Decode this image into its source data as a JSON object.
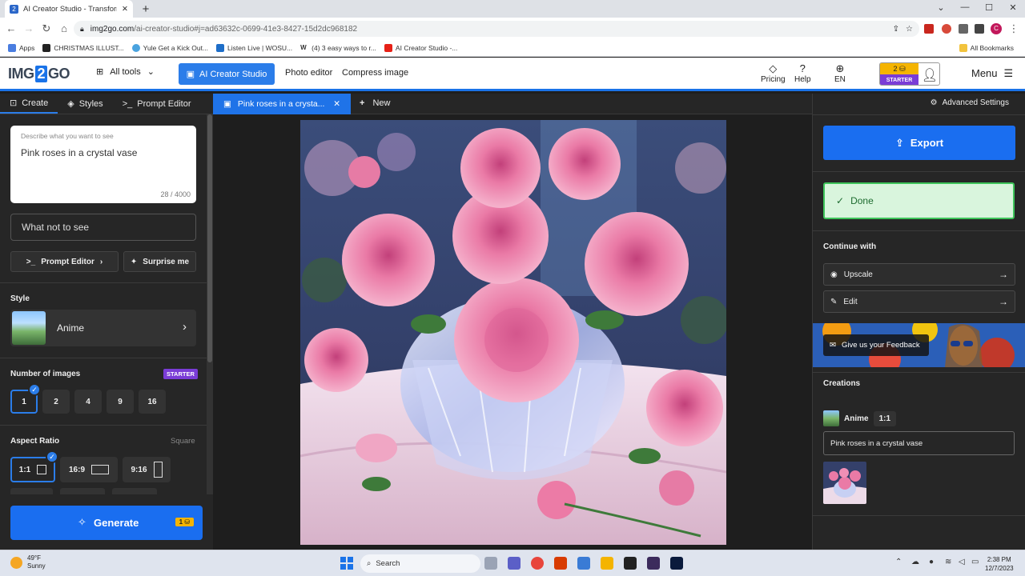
{
  "browser": {
    "tab_title": "AI Creator Studio - Transform Id",
    "url_host": "img2go.com",
    "url_path": "/ai-creator-studio#j=ad63632c-0699-41e3-8427-15d2dc968182",
    "profile_initial": "C",
    "bookmarks": [
      "Apps",
      "CHRISTMAS ILLUST...",
      "Yule Get a Kick Out...",
      "Listen Live | WOSU...",
      "(4) 3 easy ways to r...",
      "AI Creator Studio -..."
    ],
    "all_bookmarks": "All Bookmarks"
  },
  "header": {
    "logo_left": "IMG",
    "logo_mid": "2",
    "logo_right": "GO",
    "all_tools": "All tools",
    "ai_creator": "AI Creator Studio",
    "photo_editor": "Photo editor",
    "compress": "Compress image",
    "pricing": "Pricing",
    "help": "Help",
    "lang": "EN",
    "credits": "2",
    "plan": "STARTER",
    "menu": "Menu"
  },
  "left": {
    "tabs": [
      "Create",
      "Styles",
      "Prompt Editor"
    ],
    "prompt_label": "Describe what you want to see",
    "prompt_value": "Pink roses in a crystal vase",
    "prompt_count": "28 / 4000",
    "negative": "What not to see",
    "prompt_editor_btn": "Prompt Editor",
    "surprise_btn": "Surprise me",
    "style_label": "Style",
    "style_name": "Anime",
    "num_label": "Number of images",
    "num_badge": "STARTER",
    "num_options": [
      "1",
      "2",
      "4",
      "9",
      "16"
    ],
    "aspect_label": "Aspect Ratio",
    "aspect_hint": "Square",
    "aspect_options": [
      "1:1",
      "16:9",
      "9:16"
    ],
    "generate": "Generate",
    "generate_cost": "1"
  },
  "center": {
    "tab_title": "Pink roses in a crysta...",
    "new_label": "New"
  },
  "right": {
    "advanced": "Advanced Settings",
    "export": "Export",
    "done": "Done",
    "continue_with": "Continue with",
    "upscale": "Upscale",
    "edit": "Edit",
    "feedback": "Give us your Feedback",
    "creations": "Creations",
    "creation_style": "Anime",
    "creation_ratio": "1:1",
    "creation_prompt": "Pink roses in a crystal vase"
  },
  "taskbar": {
    "temp": "49°F",
    "weather": "Sunny",
    "search": "Search",
    "time": "2:38 PM",
    "date": "12/7/2023"
  },
  "colors": {
    "accent": "#1a6ef0",
    "done_green": "#3ec45a",
    "plan_purple": "#7a3cd6",
    "credit_gold": "#f5b400"
  }
}
